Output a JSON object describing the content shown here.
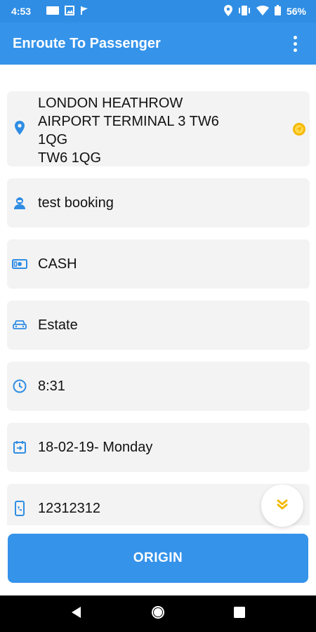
{
  "status_bar": {
    "time": "4:53",
    "battery": "56%",
    "icons": [
      "mail-icon",
      "gallery-icon",
      "flag-icon",
      "location-icon",
      "vibrate-icon",
      "wifi-icon",
      "battery-icon"
    ]
  },
  "app_bar": {
    "title": "Enroute To Passenger",
    "menu_icon": "more-vert-icon"
  },
  "details": {
    "pickup_address": " LONDON HEATHROW\nAIRPORT TERMINAL 3 TW6\n1QG\nTW6 1QG",
    "passenger_name": "test booking",
    "payment_method": "CASH",
    "vehicle_type": "Estate",
    "time": "8:31",
    "date": "18-02-19- Monday",
    "phone": "12312312"
  },
  "actions": {
    "origin_label": "ORIGIN"
  },
  "colors": {
    "primary": "#3593ea",
    "accent": "#f5b800",
    "card_bg": "#f3f3f3"
  }
}
